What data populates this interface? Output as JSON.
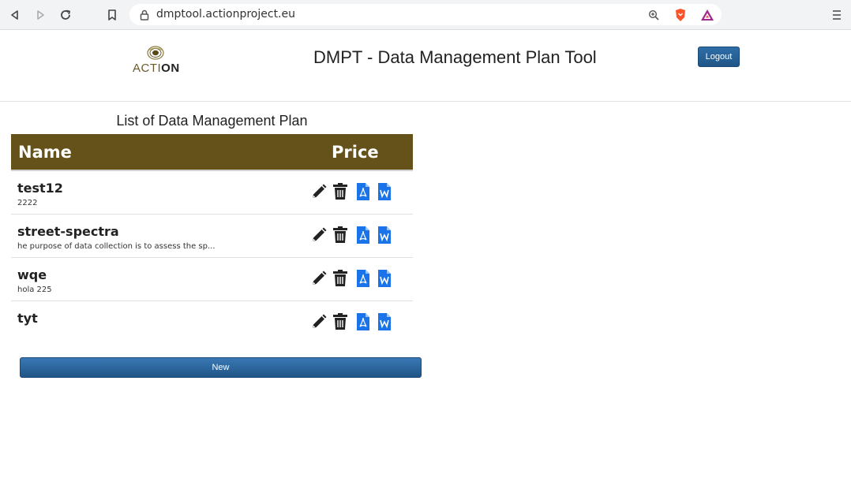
{
  "browser": {
    "url": "dmptool.actionproject.eu"
  },
  "header": {
    "logo_prefix": "ACTI",
    "logo_suffix": "ON",
    "title": "DMPT - Data Management Plan Tool",
    "logout_label": "Logout"
  },
  "list": {
    "title": "List of Data Management Plan",
    "columns": [
      "Name",
      "Price"
    ],
    "rows": [
      {
        "name": "test12",
        "description": "2222"
      },
      {
        "name": "street-spectra",
        "description": "he purpose of data collection is to assess the sp..."
      },
      {
        "name": "wqe",
        "description": "hola 225"
      },
      {
        "name": "tyt",
        "description": ""
      }
    ]
  },
  "new_label": "New",
  "colors": {
    "table_header": "#65511a",
    "button": "#1f5586",
    "doc_icon": "#1a73e8"
  }
}
